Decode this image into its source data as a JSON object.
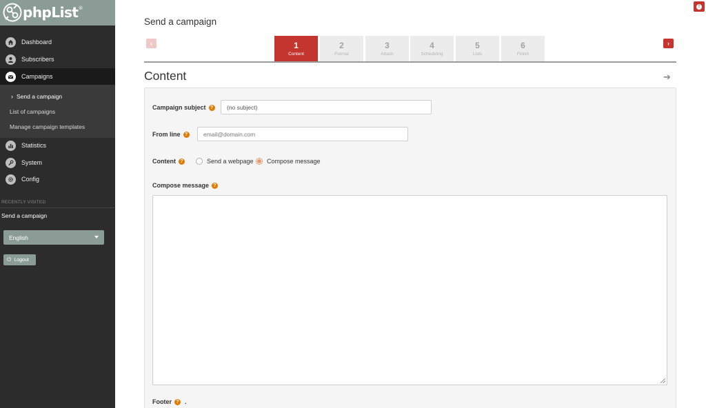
{
  "brand": {
    "name": "phpList",
    "trademark": "®"
  },
  "sidebar": {
    "nav": [
      {
        "label": "Dashboard",
        "icon": "home-icon"
      },
      {
        "label": "Subscribers",
        "icon": "user-icon"
      },
      {
        "label": "Campaigns",
        "icon": "envelope-icon"
      },
      {
        "label": "Statistics",
        "icon": "bar-chart-icon"
      },
      {
        "label": "System",
        "icon": "wrench-icon"
      },
      {
        "label": "Config",
        "icon": "gear-icon"
      }
    ],
    "campaign_sub": [
      {
        "label": "Send a campaign"
      },
      {
        "label": "List of campaigns"
      },
      {
        "label": "Manage campaign templates"
      }
    ],
    "recently_visited_label": "RECENTLY VISITED",
    "recently_visited": [
      {
        "label": "Send a campaign"
      }
    ],
    "language": "English",
    "logout_label": "Logout"
  },
  "page": {
    "title": "Send a campaign"
  },
  "steps": [
    {
      "num": "1",
      "label": "Content"
    },
    {
      "num": "2",
      "label": "Format"
    },
    {
      "num": "3",
      "label": "Attach"
    },
    {
      "num": "4",
      "label": "Scheduling"
    },
    {
      "num": "5",
      "label": "Lists"
    },
    {
      "num": "6",
      "label": "Finish"
    }
  ],
  "section": {
    "title": "Content"
  },
  "form": {
    "subject_label": "Campaign subject",
    "subject_value": "(no subject)",
    "from_label": "From line",
    "from_placeholder": "email@domain.com",
    "content_label": "Content",
    "content_options": [
      {
        "label": "Send a webpage",
        "selected": false
      },
      {
        "label": "Compose message",
        "selected": true
      }
    ],
    "compose_label": "Compose message",
    "footer_label": "Footer",
    "footer_trailing": "."
  },
  "colors": {
    "accent": "#c3352e",
    "brand": "#8a9c95",
    "help": "#e07a00"
  }
}
